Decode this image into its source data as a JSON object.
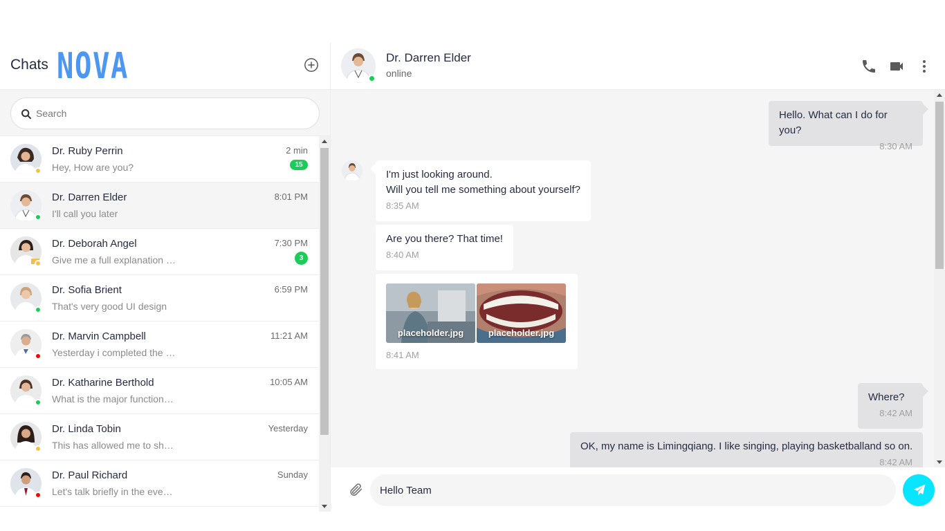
{
  "sidebar": {
    "title": "Chats",
    "brand": "NOVA",
    "search_placeholder": "Search",
    "chats": [
      {
        "name": "Dr. Ruby Perrin",
        "preview": "Hey, How are you?",
        "time": "2 min",
        "unread": "15",
        "status_color": "#f4c150"
      },
      {
        "name": "Dr. Darren Elder",
        "preview": "I'll call you later",
        "time": "8:01 PM",
        "unread": "",
        "status_color": "#1bcc59"
      },
      {
        "name": "Dr. Deborah Angel",
        "preview": "Give me a full explanation about our project",
        "time": "7:30 PM",
        "unread": "3",
        "status_color": "#f4c150"
      },
      {
        "name": "Dr. Sofia Brient",
        "preview": "That's very good UI design",
        "time": "6:59 PM",
        "unread": "",
        "status_color": "#1bcc59"
      },
      {
        "name": "Dr. Marvin Campbell",
        "preview": "Yesterday i completed the task",
        "time": "11:21 AM",
        "unread": "",
        "status_color": "#ff0100"
      },
      {
        "name": "Dr. Katharine Berthold",
        "preview": "What is the major functionality?",
        "time": "10:05 AM",
        "unread": "",
        "status_color": "#1bcc59"
      },
      {
        "name": "Dr. Linda Tobin",
        "preview": "This has allowed me to showcase",
        "time": "Yesterday",
        "unread": "",
        "status_color": "#f4c150"
      },
      {
        "name": "Dr. Paul Richard",
        "preview": "Let's talk briefly in the evening.",
        "time": "Sunday",
        "unread": "",
        "status_color": "#ff0100"
      }
    ]
  },
  "header": {
    "contact_name": "Dr. Darren Elder",
    "contact_status": "online"
  },
  "messages": {
    "m1": {
      "text": "Hello. What can I do for you?",
      "time": "8:30 AM"
    },
    "m2": {
      "line1": "I'm just looking around.",
      "line2": "Will you tell me something about yourself?",
      "time": "8:35 AM"
    },
    "m3": {
      "text": "Are you there? That time!",
      "time": "8:40 AM"
    },
    "m4": {
      "attachments": [
        "placeholder.jpg",
        "placeholder.jpg"
      ],
      "time": "8:41 AM"
    },
    "m5": {
      "text": "Where?",
      "time": "8:42 AM"
    },
    "m6": {
      "text": "OK, my name is Limingqiang. I like singing, playing basketballand so on.",
      "time": "8:42 AM"
    }
  },
  "composer": {
    "value": "Hello Team"
  },
  "colors": {
    "brand": "#4b97f2",
    "send": "#09e5ff",
    "online": "#1bcc59",
    "away": "#f4c150",
    "offline": "#ff0100",
    "unread_badge": "#1bcc59"
  },
  "icons": [
    "add-circle-icon",
    "search-icon",
    "phone-icon",
    "video-icon",
    "more-vertical-icon",
    "paperclip-icon",
    "send-icon"
  ]
}
